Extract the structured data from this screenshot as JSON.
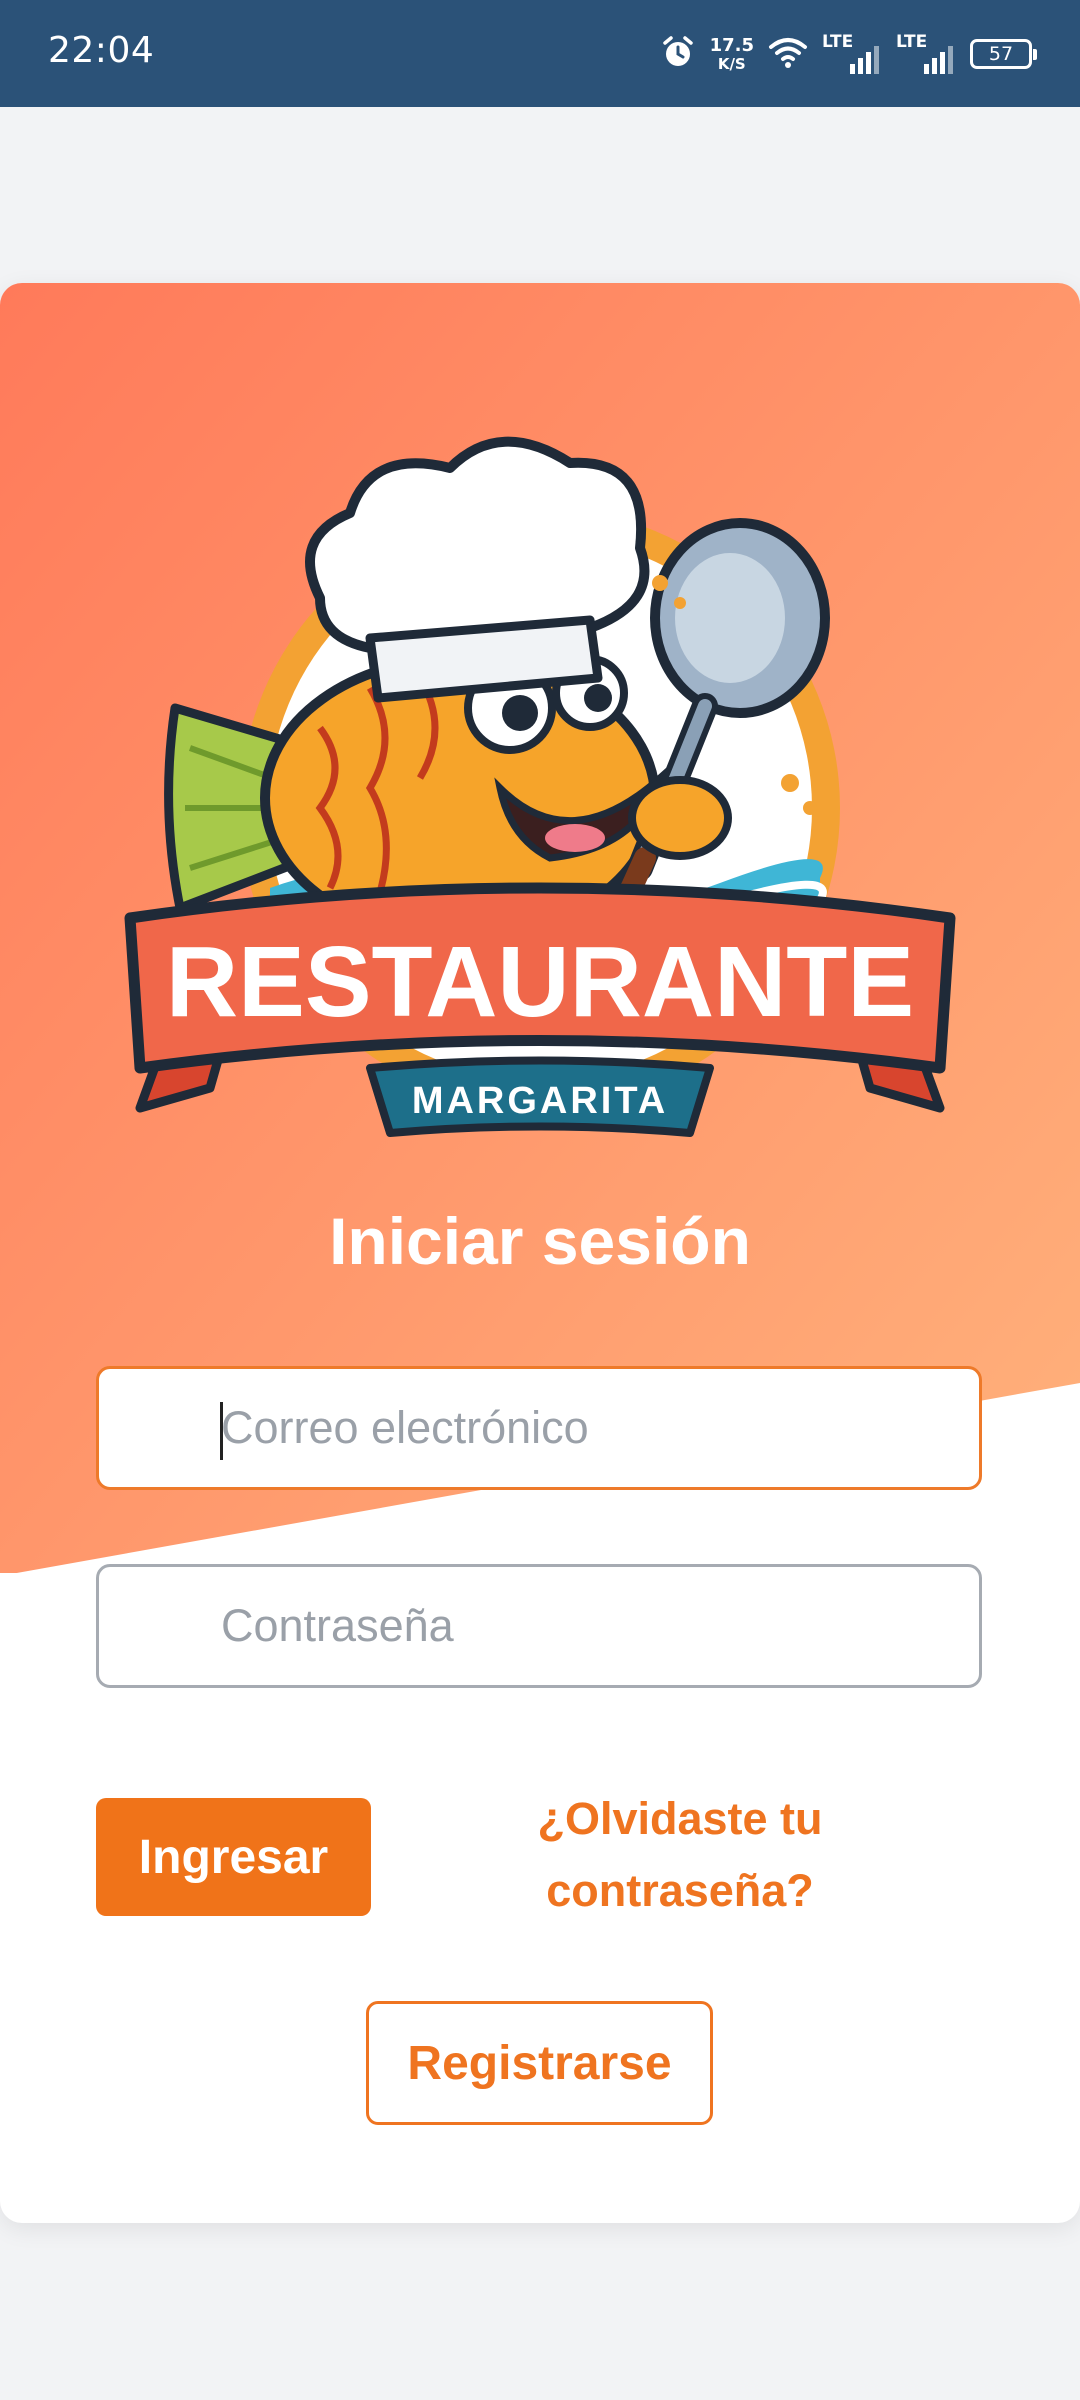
{
  "status_bar": {
    "time": "22:04",
    "net_speed_value": "17.5",
    "net_speed_unit": "K/S",
    "sim1_label": "LTE",
    "sim2_label": "LTE",
    "battery_level": "57",
    "icons": [
      "alarm-icon",
      "wifi-icon",
      "signal-icon",
      "signal-icon",
      "battery-icon"
    ]
  },
  "logo": {
    "title": "RESTAURANTE",
    "subtitle": "MARGARITA"
  },
  "login": {
    "title": "Iniciar sesión",
    "email_placeholder": "Correo electrónico",
    "email_value": "",
    "password_placeholder": "Contraseña",
    "password_value": "",
    "submit_label": "Ingresar",
    "forgot_line1": "¿Olvidaste tu",
    "forgot_line2": "contraseña?",
    "register_label": "Registrarse"
  },
  "colors": {
    "status_bar": "#2b5278",
    "accent": "#f07319",
    "hero_gradient_start": "#ff7a5a",
    "hero_gradient_end": "#ffb27c",
    "page_background": "#f2f3f5"
  }
}
